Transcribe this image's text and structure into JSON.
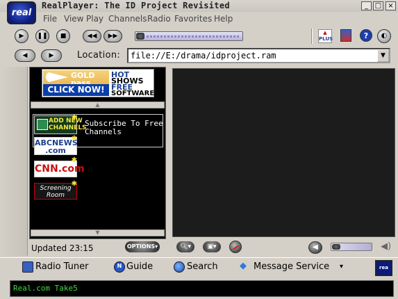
{
  "window": {
    "title": "RealPlayer: The ID Project Revisited",
    "logo_text": "real",
    "controls": [
      "_",
      "□",
      "×"
    ]
  },
  "menu": {
    "items": [
      "File",
      "View",
      "Play",
      "Channels",
      "Radio",
      "Favorites",
      "Help"
    ]
  },
  "toolbar": {
    "play_icon": "play-icon",
    "pause_icon": "pause-icon",
    "stop_icon": "stop-icon",
    "rewind_icon": "rewind-icon",
    "fastforward_icon": "fast-forward-icon",
    "plus_label": "PLUS",
    "seek_position": 0.0
  },
  "location": {
    "label": "Location:",
    "value": "file://E:/drama/idproject.ram"
  },
  "ad_banner": {
    "gold_text": "GOLD pass",
    "click_text": "CLICK NOW!",
    "right_lines": [
      "HOT",
      "SHOWS",
      "FREE",
      "SOFTWARE"
    ]
  },
  "channels": {
    "add_new": [
      "ADD NEW",
      "CHANNELS"
    ],
    "subscribe_lines": [
      "Subscribe To Free",
      "Channels"
    ],
    "abc": [
      "ABCNEWS",
      ".com"
    ],
    "cnn": "CNN.com",
    "screening": [
      "Screening",
      "Room"
    ]
  },
  "panel_footer": {
    "updated": "Updated 23:15",
    "options": "OPTIONS▾"
  },
  "bottom_bar": {
    "radio_tuner": "Radio Tuner",
    "guide": "Guide",
    "search": "Search",
    "message_service": "Message Service",
    "dropdown": "▾"
  },
  "status": {
    "text": "Real.com Take5"
  },
  "colors": {
    "status_text": "#3ddc3d",
    "logo_bg": "#0b1a7c",
    "click_bg": "#0a3ea8"
  }
}
